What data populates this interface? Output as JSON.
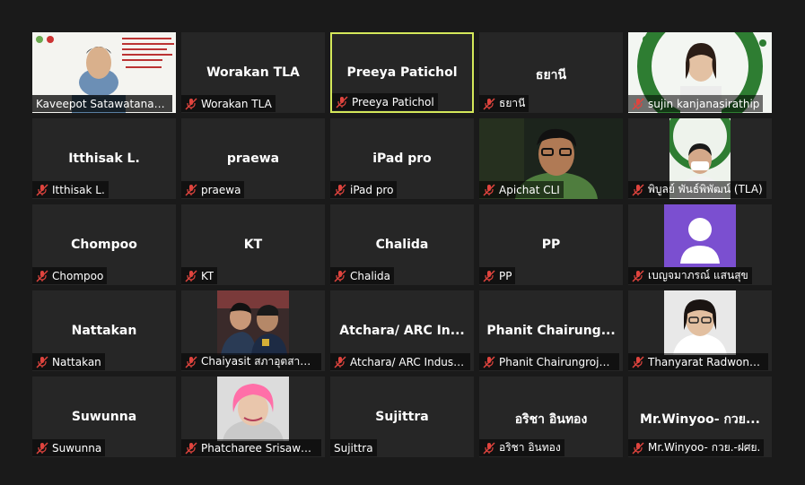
{
  "colors": {
    "background": "#1a1a1a",
    "tile": "#262626",
    "active_speaker_border": "#d4e85a",
    "muted_icon": "#e0443e"
  },
  "participants": [
    {
      "display_name": "Kaveepot Satawatananon",
      "label": "Kaveepot Satawatananon",
      "video": true,
      "muted": false
    },
    {
      "display_name": "Worakan TLA",
      "label": "Worakan TLA",
      "video": false,
      "muted": true
    },
    {
      "display_name": "Preeya Patichol",
      "label": "Preeya Patichol",
      "video": false,
      "muted": true,
      "active_speaker": true
    },
    {
      "display_name": "ธยานี",
      "label": "ธยานี",
      "video": false,
      "muted": true
    },
    {
      "display_name": "sujin kanjanasirathip",
      "label": "sujin kanjanasirathip",
      "video": true,
      "muted": true
    },
    {
      "display_name": "Itthisak L.",
      "label": "Itthisak L.",
      "video": false,
      "muted": true
    },
    {
      "display_name": "praewa",
      "label": "praewa",
      "video": false,
      "muted": true
    },
    {
      "display_name": "iPad pro",
      "label": "iPad pro",
      "video": false,
      "muted": true
    },
    {
      "display_name": "Apichat CLI",
      "label": "Apichat CLI",
      "video": true,
      "muted": true
    },
    {
      "display_name": "พิบูลย์ พันธ์พิพัฒน์ (TLA)",
      "label": "พิบูลย์ พันธ์พิพัฒน์ (TLA)",
      "video": true,
      "muted": true
    },
    {
      "display_name": "Chompoo",
      "label": "Chompoo",
      "video": false,
      "muted": true
    },
    {
      "display_name": "KT",
      "label": "KT",
      "video": false,
      "muted": true
    },
    {
      "display_name": "Chalida",
      "label": "Chalida",
      "video": false,
      "muted": true
    },
    {
      "display_name": "PP",
      "label": "PP",
      "video": false,
      "muted": true
    },
    {
      "display_name": "เบญจมาภรณ์ แสนสุข",
      "label": "เบญจมาภรณ์ แสนสุข",
      "video": false,
      "avatar": true,
      "muted": true
    },
    {
      "display_name": "Nattakan",
      "label": "Nattakan",
      "video": false,
      "muted": true
    },
    {
      "display_name": "Chaiyasit สภาอุตสาหกรรม",
      "label": "Chaiyasit สภาอุตสาหก...",
      "video": true,
      "muted": true
    },
    {
      "display_name": "Atchara/ ARC In...",
      "label": "Atchara/ ARC Industry",
      "video": false,
      "muted": true
    },
    {
      "display_name": "Phanit  Chairung...",
      "label": "Phanit Chairungrojpa...",
      "video": false,
      "muted": true
    },
    {
      "display_name": "Thanyarat Radwongwit",
      "label": "Thanyarat Radwongw...",
      "video": true,
      "muted": true
    },
    {
      "display_name": "Suwunna",
      "label": "Suwunna",
      "video": false,
      "muted": true
    },
    {
      "display_name": "Phatcharee Srisawang",
      "label": "Phatcharee Srisawang",
      "video": true,
      "muted": true
    },
    {
      "display_name": "Sujittra",
      "label": "Sujittra",
      "video": false,
      "muted": false
    },
    {
      "display_name": "อริชา  อินทอง",
      "label": "อริชา  อินทอง",
      "video": false,
      "muted": true
    },
    {
      "display_name": "Mr.Winyoo- กวย...",
      "label": "Mr.Winyoo- กวย.-ฝศย.",
      "video": false,
      "muted": true
    }
  ]
}
